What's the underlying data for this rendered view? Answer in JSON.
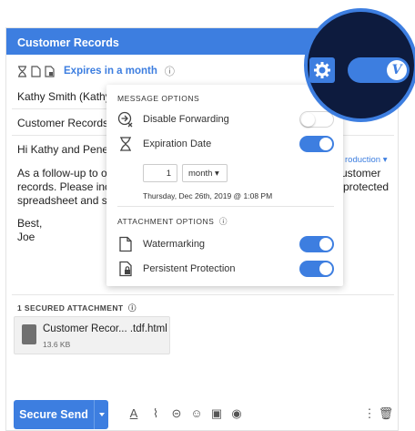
{
  "compose": {
    "title": "Customer Records",
    "expires_label": "Expires in a month",
    "to_field": "Kathy Smith (Kathy@",
    "subject": "Customer Records",
    "greeting": "Hi Kathy and Penelo",
    "body_lines": [
      "As a follow-up to our",
      "records. Please inco",
      "spreadsheet and sen"
    ],
    "body_right_lines": [
      "customer",
      "n protected"
    ],
    "intro_link": "roduction",
    "signoff": "Best,",
    "signature": "Joe"
  },
  "panel": {
    "message_options_label": "MESSAGE OPTIONS",
    "disable_forwarding_label": "Disable Forwarding",
    "disable_forwarding_on": false,
    "expiration_date_label": "Expiration Date",
    "expiration_date_on": true,
    "expiration_amount": "1",
    "expiration_unit": "month",
    "expiration_date_note": "Thursday, Dec 26th, 2019 @ 1:08 PM",
    "attachment_options_label": "ATTACHMENT OPTIONS",
    "watermarking_label": "Watermarking",
    "watermarking_on": true,
    "persistent_protection_label": "Persistent Protection",
    "persistent_protection_on": true
  },
  "attachments": {
    "section_label": "1 SECURED ATTACHMENT",
    "items": [
      {
        "name": "Customer Recor... .tdf.html",
        "size": "13.6 KB",
        "icon_badge": "XLSX"
      }
    ]
  },
  "toolbar": {
    "send_label": "Secure Send",
    "tools": [
      "format-text-icon",
      "attach-icon",
      "link-icon",
      "emoji-icon",
      "image-icon",
      "lock-clock-icon"
    ]
  },
  "overlay": {
    "logo_letter": "V",
    "enabled": true
  },
  "colors": {
    "accent": "#3d7ee0",
    "overlay_bg": "#0d1b3e"
  }
}
